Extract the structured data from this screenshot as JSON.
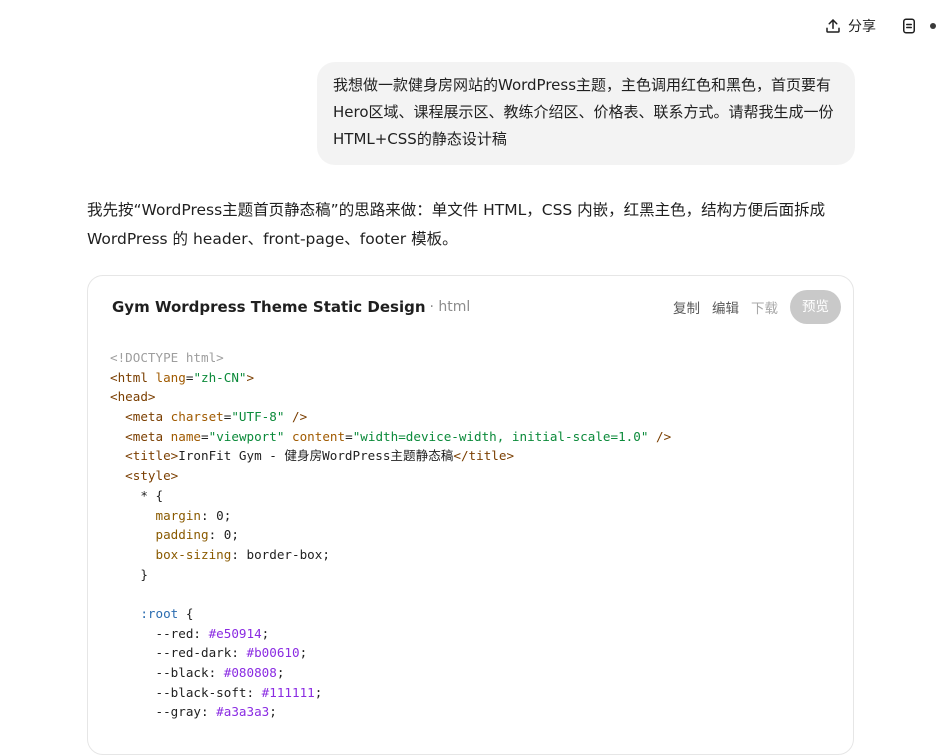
{
  "toolbar": {
    "share_label": "分享"
  },
  "user_message": {
    "text": "我想做一款健身房网站的WordPress主题，主色调用红色和黑色，首页要有Hero区域、课程展示区、教练介绍区、价格表、联系方式。请帮我生成一份HTML+CSS的静态设计稿"
  },
  "assistant_message": {
    "text": "我先按“WordPress主题首页静态稿”的思路来做：单文件 HTML，CSS 内嵌，红黑主色，结构方便后面拆成 WordPress 的 header、front-page、footer 模板。"
  },
  "code_card": {
    "title": "Gym Wordpress Theme Static Design",
    "lang": "· html",
    "actions": {
      "copy": "复制",
      "edit": "编辑",
      "download": "下载",
      "preview": "预览"
    },
    "lines": [
      [
        {
          "c": "t-doctype",
          "t": "<!DOCTYPE html>"
        }
      ],
      [
        {
          "c": "t-tag",
          "t": "<html "
        },
        {
          "c": "t-attr",
          "t": "lang"
        },
        {
          "c": "t-punct",
          "t": "="
        },
        {
          "c": "t-str",
          "t": "\"zh-CN\""
        },
        {
          "c": "t-tag",
          "t": ">"
        }
      ],
      [
        {
          "c": "t-tag",
          "t": "<head>"
        }
      ],
      [
        {
          "c": "t-indent",
          "t": "  "
        },
        {
          "c": "t-tag",
          "t": "<meta "
        },
        {
          "c": "t-attr",
          "t": "charset"
        },
        {
          "c": "t-punct",
          "t": "="
        },
        {
          "c": "t-str",
          "t": "\"UTF-8\""
        },
        {
          "c": "t-tag",
          "t": " />"
        }
      ],
      [
        {
          "c": "t-indent",
          "t": "  "
        },
        {
          "c": "t-tag",
          "t": "<meta "
        },
        {
          "c": "t-attr",
          "t": "name"
        },
        {
          "c": "t-punct",
          "t": "="
        },
        {
          "c": "t-str",
          "t": "\"viewport\""
        },
        {
          "c": "t-attr",
          "t": " content"
        },
        {
          "c": "t-punct",
          "t": "="
        },
        {
          "c": "t-str",
          "t": "\"width=device-width, initial-scale=1.0\""
        },
        {
          "c": "t-tag",
          "t": " />"
        }
      ],
      [
        {
          "c": "t-indent",
          "t": "  "
        },
        {
          "c": "t-tag",
          "t": "<title>"
        },
        {
          "c": "t-text",
          "t": "IronFit Gym - 健身房WordPress主题静态稿"
        },
        {
          "c": "t-tag",
          "t": "</title>"
        }
      ],
      [
        {
          "c": "t-indent",
          "t": "  "
        },
        {
          "c": "t-tag",
          "t": "<style>"
        }
      ],
      [
        {
          "c": "t-indent",
          "t": "    "
        },
        {
          "c": "t-sel",
          "t": "* {"
        }
      ],
      [
        {
          "c": "t-indent",
          "t": "      "
        },
        {
          "c": "t-prop",
          "t": "margin"
        },
        {
          "c": "t-punct",
          "t": ": "
        },
        {
          "c": "t-num",
          "t": "0"
        },
        {
          "c": "t-punct",
          "t": ";"
        }
      ],
      [
        {
          "c": "t-indent",
          "t": "      "
        },
        {
          "c": "t-prop",
          "t": "padding"
        },
        {
          "c": "t-punct",
          "t": ": "
        },
        {
          "c": "t-num",
          "t": "0"
        },
        {
          "c": "t-punct",
          "t": ";"
        }
      ],
      [
        {
          "c": "t-indent",
          "t": "      "
        },
        {
          "c": "t-prop",
          "t": "box-sizing"
        },
        {
          "c": "t-punct",
          "t": ": "
        },
        {
          "c": "t-num",
          "t": "border-box"
        },
        {
          "c": "t-punct",
          "t": ";"
        }
      ],
      [
        {
          "c": "t-indent",
          "t": "    "
        },
        {
          "c": "t-sel",
          "t": "}"
        }
      ],
      [
        {
          "c": "t-indent",
          "t": ""
        }
      ],
      [
        {
          "c": "t-indent",
          "t": "    "
        },
        {
          "c": "t-kw",
          "t": ":root"
        },
        {
          "c": "t-sel",
          "t": " {"
        }
      ],
      [
        {
          "c": "t-indent",
          "t": "      "
        },
        {
          "c": "t-var",
          "t": "--red"
        },
        {
          "c": "t-punct",
          "t": ": "
        },
        {
          "c": "t-color",
          "t": "#e50914"
        },
        {
          "c": "t-punct",
          "t": ";"
        }
      ],
      [
        {
          "c": "t-indent",
          "t": "      "
        },
        {
          "c": "t-var",
          "t": "--red-dark"
        },
        {
          "c": "t-punct",
          "t": ": "
        },
        {
          "c": "t-color",
          "t": "#b00610"
        },
        {
          "c": "t-punct",
          "t": ";"
        }
      ],
      [
        {
          "c": "t-indent",
          "t": "      "
        },
        {
          "c": "t-var",
          "t": "--black"
        },
        {
          "c": "t-punct",
          "t": ": "
        },
        {
          "c": "t-color",
          "t": "#080808"
        },
        {
          "c": "t-punct",
          "t": ";"
        }
      ],
      [
        {
          "c": "t-indent",
          "t": "      "
        },
        {
          "c": "t-var",
          "t": "--black-soft"
        },
        {
          "c": "t-punct",
          "t": ": "
        },
        {
          "c": "t-color",
          "t": "#111111"
        },
        {
          "c": "t-punct",
          "t": ";"
        }
      ],
      [
        {
          "c": "t-indent",
          "t": "      "
        },
        {
          "c": "t-var",
          "t": "--gray"
        },
        {
          "c": "t-punct",
          "t": ": "
        },
        {
          "c": "t-color",
          "t": "#a3a3a3"
        },
        {
          "c": "t-punct",
          "t": ";"
        }
      ]
    ]
  }
}
